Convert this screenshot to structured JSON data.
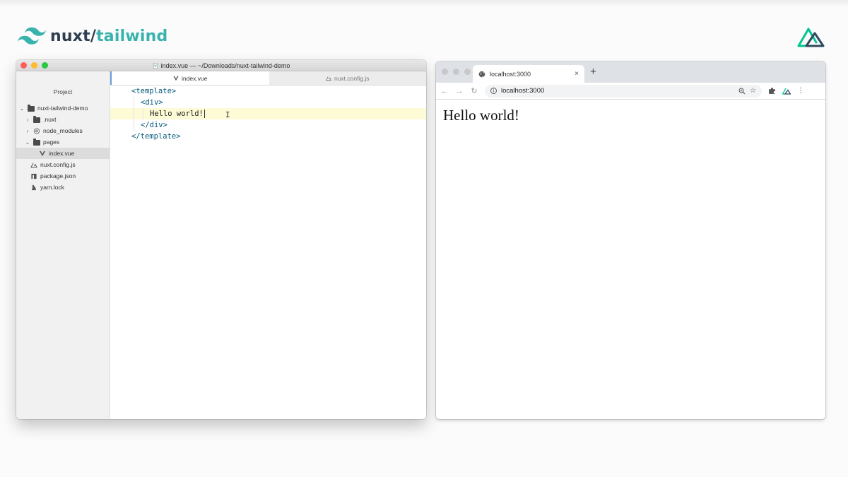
{
  "brand": {
    "name_part1": "nuxt",
    "separator": "/",
    "name_part2": "tailwind",
    "accent_color": "#38b2ac",
    "dark_color": "#2c3e50"
  },
  "editor": {
    "window_title": "index.vue — ~/Downloads/nuxt-tailwind-demo",
    "sidebar_header": "Project",
    "tree": [
      {
        "label": "nuxt-tailwind-demo",
        "icon": "folder-icon",
        "chevron": "down"
      },
      {
        "label": ".nuxt",
        "icon": "folder-icon",
        "chevron": "right"
      },
      {
        "label": "node_modules",
        "icon": "package-icon",
        "chevron": "right"
      },
      {
        "label": "pages",
        "icon": "folder-icon",
        "chevron": "down"
      },
      {
        "label": "index.vue",
        "icon": "vue-icon",
        "selected": true
      },
      {
        "label": "nuxt.config.js",
        "icon": "nuxt-icon"
      },
      {
        "label": "package.json",
        "icon": "npm-icon"
      },
      {
        "label": "yarn.lock",
        "icon": "yarn-icon"
      }
    ],
    "tabs": [
      {
        "label": "index.vue",
        "icon": "vue-icon",
        "active": true
      },
      {
        "label": "nuxt.config.js",
        "icon": "nuxt-icon",
        "active": false
      }
    ],
    "code": {
      "line1": "<template>",
      "line2": "<div>",
      "line3": "Hello world!",
      "line4": "</div>",
      "line5": "</template>"
    }
  },
  "browser": {
    "tab_title": "localhost:3000",
    "new_tab": "+",
    "close": "×",
    "url": "localhost:3000",
    "page_heading": "Hello world!"
  }
}
